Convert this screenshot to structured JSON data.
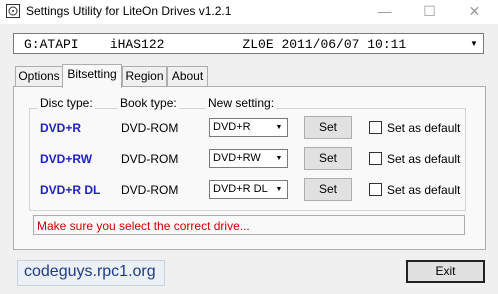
{
  "window": {
    "title": "Settings Utility for LiteOn Drives v1.2.1",
    "minimize": "—",
    "maximize": "☐",
    "close": "✕"
  },
  "drive_select": {
    "value": "G:ATAPI    iHAS122          ZL0E 2011/06/07 10:11"
  },
  "tabs": [
    {
      "label": "Options"
    },
    {
      "label": "Bitsetting"
    },
    {
      "label": "Region"
    },
    {
      "label": "About"
    }
  ],
  "active_tab": "Bitsetting",
  "headers": {
    "disc_type": "Disc type:",
    "book_type": "Book type:",
    "new_setting": "New setting:"
  },
  "rows": [
    {
      "disc": "DVD+R",
      "book": "DVD-ROM",
      "setting": "DVD+R",
      "button": "Set",
      "default_label": "Set as default",
      "default_checked": false
    },
    {
      "disc": "DVD+RW",
      "book": "DVD-ROM",
      "setting": "DVD+RW",
      "button": "Set",
      "default_label": "Set as default",
      "default_checked": false
    },
    {
      "disc": "DVD+R DL",
      "book": "DVD-ROM",
      "setting": "DVD+R DL",
      "button": "Set",
      "default_label": "Set as default",
      "default_checked": false
    }
  ],
  "status": {
    "message": "Make sure you select the correct drive..."
  },
  "footer": {
    "logo": "codeguys.rpc1.org",
    "exit": "Exit"
  },
  "colors": {
    "disc_type": "#1e1ecc",
    "status_text": "#d00000",
    "logo_text": "#1f3a8a"
  }
}
